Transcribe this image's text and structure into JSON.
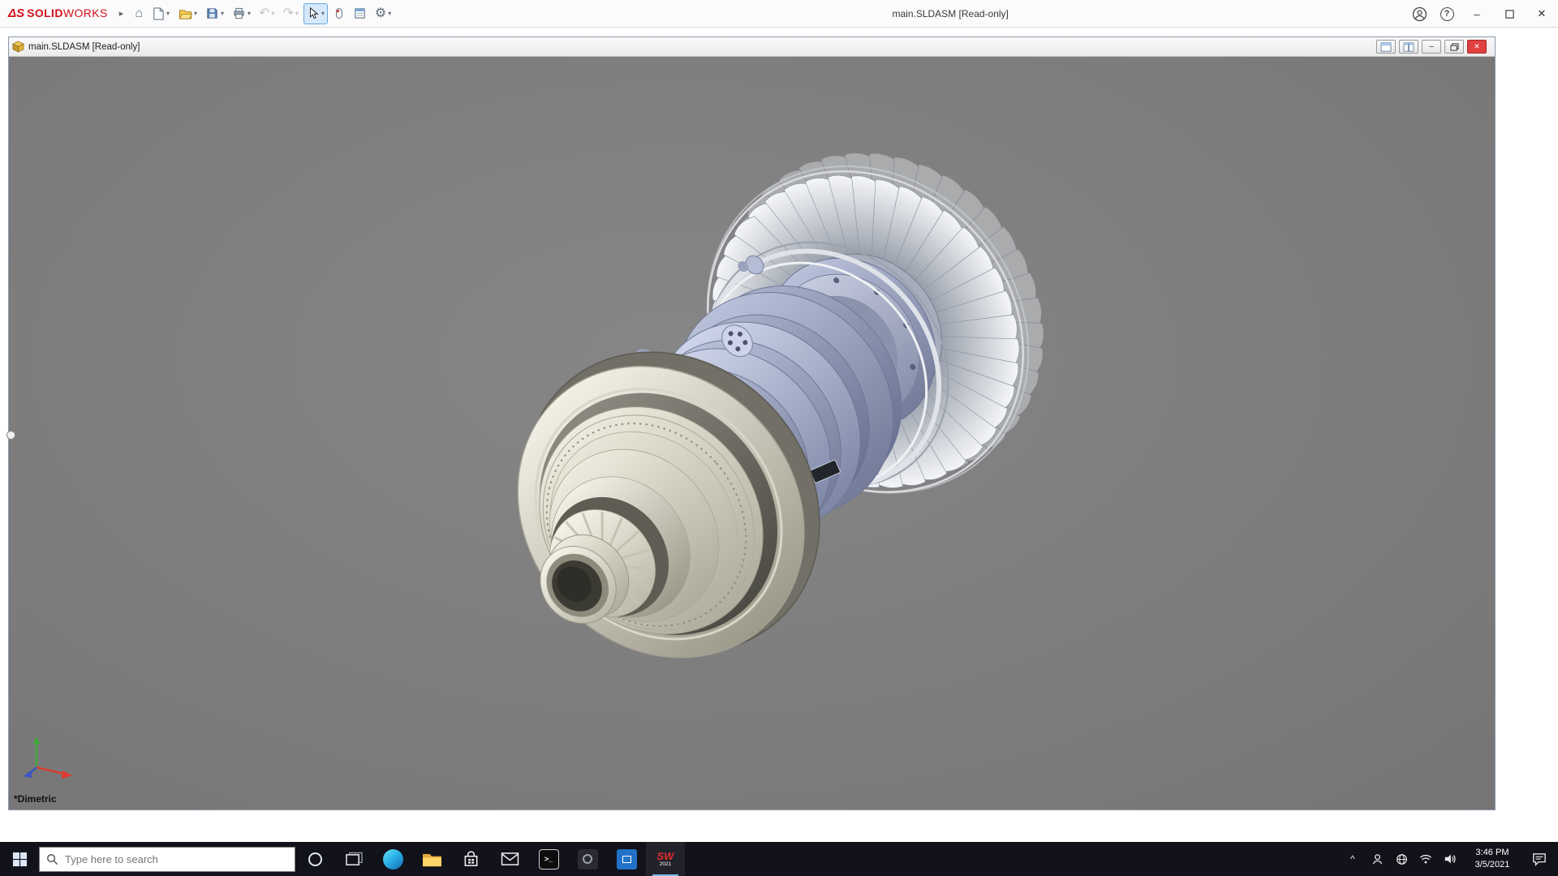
{
  "titlebar": {
    "brand_prefix": "ΔS",
    "brand_solid": "SOLID",
    "brand_works": "WORKS",
    "window_title": "main.SLDASM [Read-only]",
    "quick_access_tools": [
      "home",
      "new-document",
      "open",
      "save",
      "print",
      "undo",
      "redo",
      "select",
      "mouse-gestures",
      "command-manager",
      "options"
    ]
  },
  "doc_window": {
    "title": "main.SLDASM [Read-only]"
  },
  "viewport": {
    "view_orientation_label": "*Dimetric",
    "background_color": "#7d7d7d",
    "model": {
      "name": "jet-engine-assembly",
      "colors": {
        "cream": "#d9d6c9",
        "lavender": "#b4bcd8",
        "silver": "#e8eaee",
        "dark_core": "#3c3b33"
      },
      "triad_colors": {
        "x": "#e03a2c",
        "y": "#3faa36",
        "z": "#3753c8"
      }
    }
  },
  "taskbar": {
    "search_placeholder": "Type here to search",
    "apps": [
      "start",
      "search",
      "cortana",
      "task-view",
      "edge",
      "file-explorer",
      "store",
      "mail",
      "terminal",
      "dark-app",
      "remote-desktop",
      "solidworks"
    ],
    "terminal_glyph": ">_",
    "solidworks_badge": {
      "letters": "SW",
      "year": "2021"
    },
    "clock": {
      "time": "3:46 PM",
      "date": "3/5/2021"
    }
  },
  "glyphs": {
    "home": "⌂",
    "undo": "↶",
    "redo": "↷",
    "gear": "⚙",
    "caret": "▾",
    "expand_arrow": "▸",
    "tray_chevron": "^",
    "minimize": "–",
    "close": "✕",
    "help": "?"
  },
  "colors": {
    "brand_red": "#d4121c",
    "taskbar_bg": "#12121b",
    "accent_blue": "#76b9ed",
    "close_red": "#e04040"
  }
}
